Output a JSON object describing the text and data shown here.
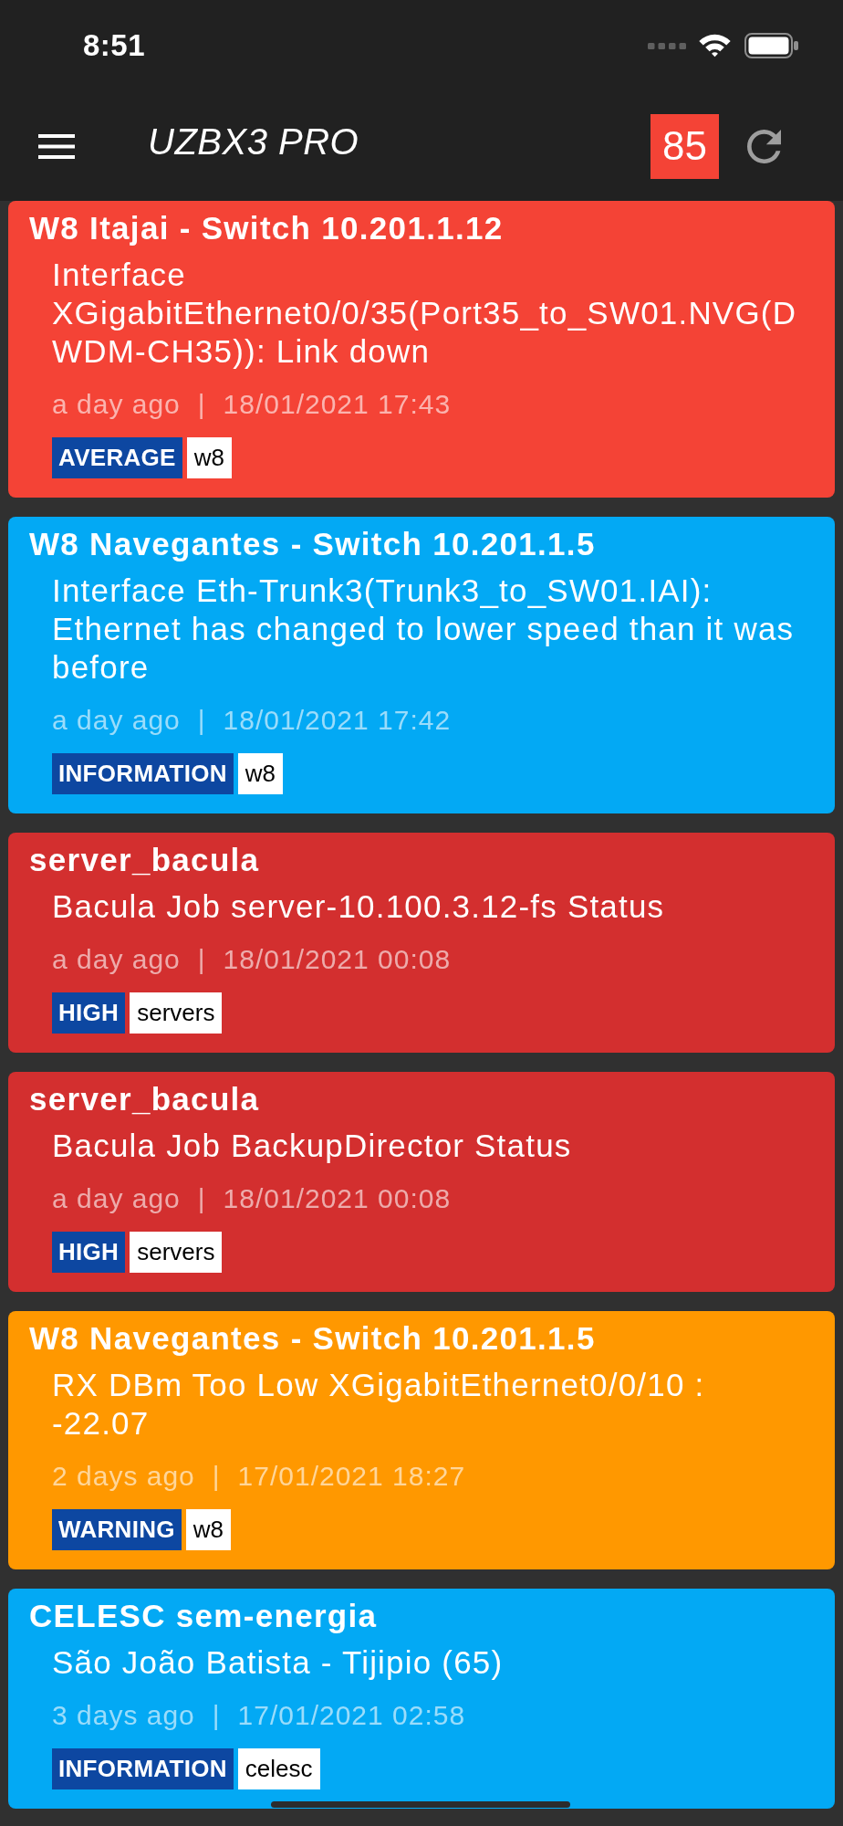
{
  "status_bar": {
    "time": "8:51"
  },
  "app_bar": {
    "title": "UZBX3 PRO",
    "badge": "85"
  },
  "alerts": [
    {
      "host": "W8 Itajai - Switch 10.201.1.12",
      "message": "Interface XGigabitEthernet0/0/35(Port35_to_SW01.NVG(DWDM-CH35)): Link down",
      "age": "a day ago",
      "separator": "|",
      "timestamp": "18/01/2021 17:43",
      "severity": "AVERAGE",
      "tag": "w8",
      "color": "#f44336"
    },
    {
      "host": "W8 Navegantes - Switch 10.201.1.5",
      "message": "Interface Eth-Trunk3(Trunk3_to_SW01.IAI): Ethernet has changed to lower speed than it was before",
      "age": "a day ago",
      "separator": "|",
      "timestamp": "18/01/2021 17:42",
      "severity": "INFORMATION",
      "tag": "w8",
      "color": "#03a9f4"
    },
    {
      "host": "server_bacula",
      "message": "Bacula Job server-10.100.3.12-fs Status",
      "age": "a day ago",
      "separator": "|",
      "timestamp": "18/01/2021 00:08",
      "severity": "HIGH",
      "tag": "servers",
      "color": "#d32f2f"
    },
    {
      "host": "server_bacula",
      "message": "Bacula Job BackupDirector Status",
      "age": "a day ago",
      "separator": "|",
      "timestamp": "18/01/2021 00:08",
      "severity": "HIGH",
      "tag": "servers",
      "color": "#d32f2f"
    },
    {
      "host": "W8 Navegantes - Switch 10.201.1.5",
      "message": "RX DBm Too Low XGigabitEthernet0/0/10 : -22.07",
      "age": "2 days ago",
      "separator": "|",
      "timestamp": "17/01/2021 18:27",
      "severity": "WARNING",
      "tag": "w8",
      "color": "#ff9800"
    },
    {
      "host": "CELESC sem-energia",
      "message": "São João Batista - Tijipio (65)",
      "age": "3 days ago",
      "separator": "|",
      "timestamp": "17/01/2021 02:58",
      "severity": "INFORMATION",
      "tag": "celesc",
      "color": "#03a9f4"
    }
  ]
}
